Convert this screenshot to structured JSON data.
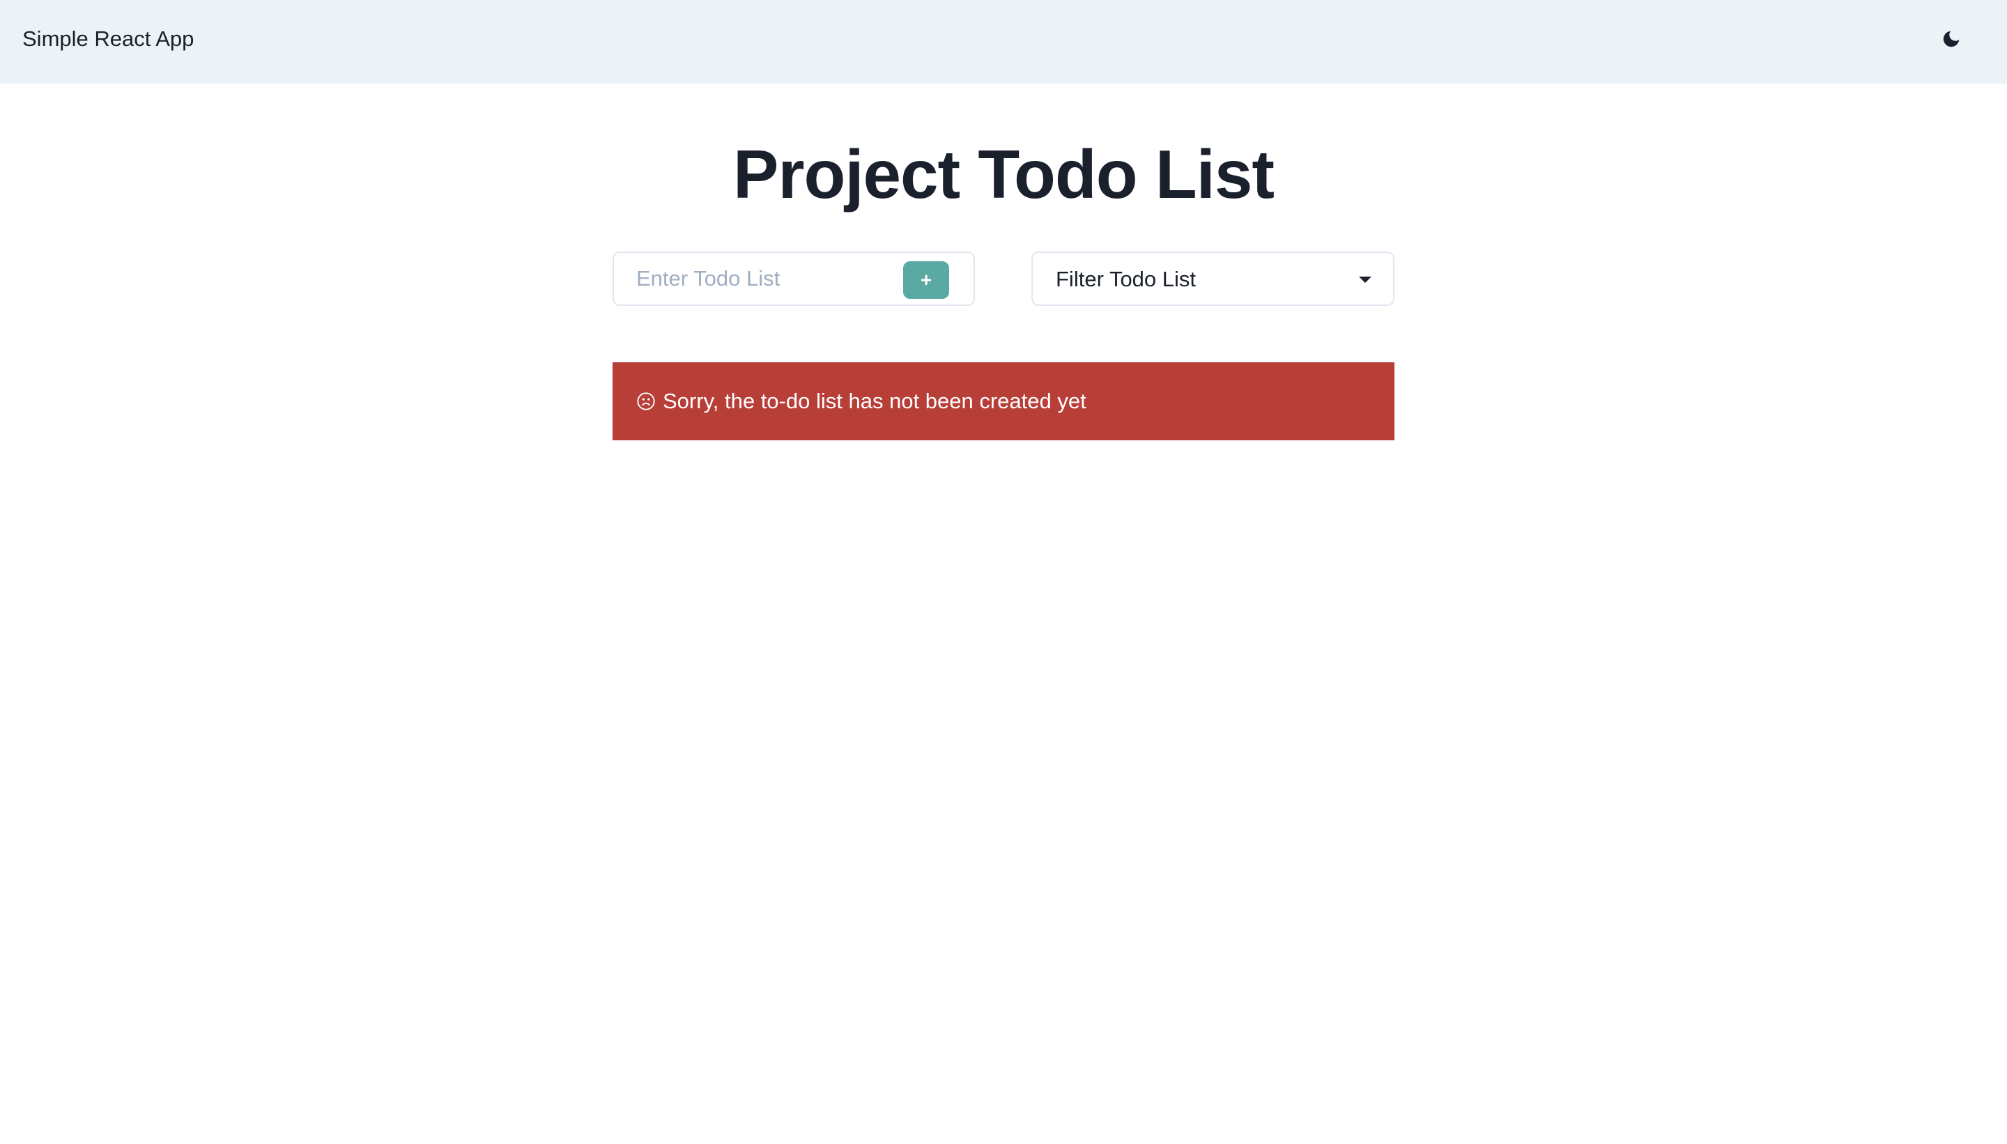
{
  "navbar": {
    "brand": "Simple React App",
    "theme_toggle_icon": "moon-icon"
  },
  "main": {
    "title": "Project Todo List",
    "todo_input": {
      "value": "",
      "placeholder": "Enter Todo List"
    },
    "add_button_label": "+",
    "filter": {
      "selected_label": "Filter Todo List",
      "caret_icon": "chevron-down-icon"
    },
    "alert": {
      "icon": "sad-face-icon",
      "message": "Sorry, the to-do list has not been created yet"
    }
  },
  "colors": {
    "navbar_bg": "#edf2f7",
    "accent": "#5aa9a3",
    "alert_bg": "#b83e38",
    "text": "#1a202c",
    "placeholder": "#a0aec0"
  }
}
